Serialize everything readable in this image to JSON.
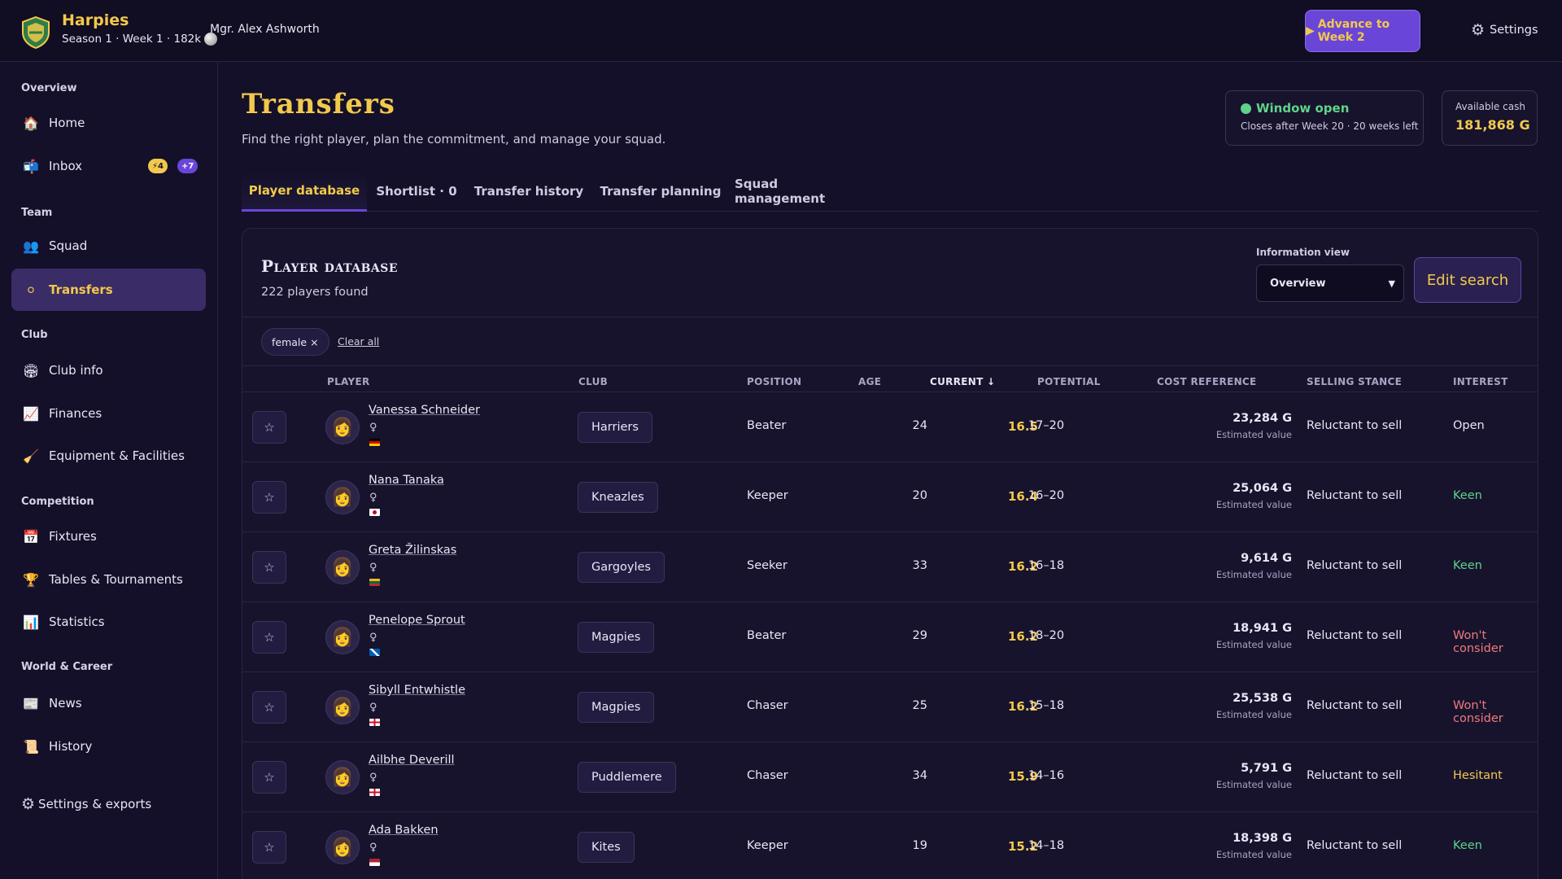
{
  "header": {
    "club_name": "Harpies",
    "club_sub": "Season 1 · Week 1 · 182k",
    "manager": "Mgr. Alex Ashworth",
    "advance_label": "Advance to Week 2",
    "settings_label": "Settings",
    "colors": {
      "accent": "#f2c94c",
      "primary": "#6a46d8"
    }
  },
  "sidebar": {
    "sections": [
      {
        "label": "Overview"
      },
      {
        "label": "Team"
      },
      {
        "label": "Club"
      },
      {
        "label": "Competition"
      },
      {
        "label": "World & Career"
      }
    ],
    "items": [
      {
        "label": "Home",
        "icon": "home-icon"
      },
      {
        "label": "Inbox",
        "icon": "inbox-icon",
        "badge_warn": "4",
        "badge_count": "+7"
      },
      {
        "label": "Squad",
        "icon": "squad-icon"
      },
      {
        "label": "Transfers",
        "icon": "transfers-icon",
        "active": true
      },
      {
        "label": "Club info",
        "icon": "club-info-icon"
      },
      {
        "label": "Finances",
        "icon": "finances-icon"
      },
      {
        "label": "Equipment & Facilities",
        "icon": "broom-icon"
      },
      {
        "label": "Fixtures",
        "icon": "calendar-icon"
      },
      {
        "label": "Tables & Tournaments",
        "icon": "trophy-icon"
      },
      {
        "label": "Statistics",
        "icon": "statistics-icon"
      },
      {
        "label": "News",
        "icon": "news-icon"
      },
      {
        "label": "History",
        "icon": "history-icon"
      }
    ],
    "settings_exports": "Settings & exports"
  },
  "page": {
    "title": "Transfers",
    "subtitle": "Find the right player, plan the commitment, and manage your squad.",
    "window": {
      "title": "Window open",
      "sub": "Closes after Week 20 · 20 weeks left"
    },
    "cash": {
      "label": "Available cash",
      "value": "181,868 G"
    },
    "tabs": [
      {
        "label": "Player database",
        "active": true
      },
      {
        "label": "Shortlist · 0"
      },
      {
        "label": "Transfer history"
      },
      {
        "label": "Transfer planning"
      },
      {
        "label": "Squad management"
      }
    ]
  },
  "panel": {
    "title": "Player database",
    "count": "222 players found",
    "info_view_label": "Information view",
    "info_view_value": "Overview",
    "edit_search": "Edit search",
    "filter_chip": "female ×",
    "clear_all": "Clear all",
    "columns": [
      "PLAYER",
      "CLUB",
      "POSITION",
      "AGE",
      "CURRENT ↓",
      "POTENTIAL",
      "COST REFERENCE",
      "SELLING STANCE",
      "INTEREST"
    ],
    "estimated_label": "Estimated value",
    "players": [
      {
        "name": "Vanessa Schneider",
        "gender": "♀",
        "flag": "de",
        "club": "Harriers",
        "position": "Beater",
        "age": "24",
        "current": "16.5",
        "potential": "17–20",
        "cost": "23,284 G",
        "stance": "Reluctant to sell",
        "interest": "Open",
        "interest_color": "#e9e6f5"
      },
      {
        "name": "Nana Tanaka",
        "gender": "♀",
        "flag": "jp",
        "club": "Kneazles",
        "position": "Keeper",
        "age": "20",
        "current": "16.4",
        "potential": "16–20",
        "cost": "25,064 G",
        "stance": "Reluctant to sell",
        "interest": "Keen",
        "interest_color": "#5fd38a"
      },
      {
        "name": "Greta Žilinskas",
        "gender": "♀",
        "flag": "lt",
        "club": "Gargoyles",
        "position": "Seeker",
        "age": "33",
        "current": "16.2",
        "potential": "16–18",
        "cost": "9,614 G",
        "stance": "Reluctant to sell",
        "interest": "Keen",
        "interest_color": "#5fd38a"
      },
      {
        "name": "Penelope Sprout",
        "gender": "♀",
        "flag": "sc",
        "club": "Magpies",
        "position": "Beater",
        "age": "29",
        "current": "16.2",
        "potential": "18–20",
        "cost": "18,941 G",
        "stance": "Reluctant to sell",
        "interest": "Won't consider",
        "interest_color": "#f07a7a"
      },
      {
        "name": "Sibyll Entwhistle",
        "gender": "♀",
        "flag": "en",
        "club": "Magpies",
        "position": "Chaser",
        "age": "25",
        "current": "16.2",
        "potential": "15–18",
        "cost": "25,538 G",
        "stance": "Reluctant to sell",
        "interest": "Won't consider",
        "interest_color": "#f07a7a"
      },
      {
        "name": "Ailbhe Deverill",
        "gender": "♀",
        "flag": "en",
        "club": "Puddlemere",
        "position": "Chaser",
        "age": "34",
        "current": "15.9",
        "potential": "14–16",
        "cost": "5,791 G",
        "stance": "Reluctant to sell",
        "interest": "Hesitant",
        "interest_color": "#f2c94c"
      },
      {
        "name": "Ada Bakken",
        "gender": "♀",
        "flag": "us",
        "club": "Kites",
        "position": "Keeper",
        "age": "19",
        "current": "15.2",
        "potential": "14–18",
        "cost": "18,398 G",
        "stance": "Reluctant to sell",
        "interest": "Keen",
        "interest_color": "#5fd38a"
      }
    ]
  }
}
